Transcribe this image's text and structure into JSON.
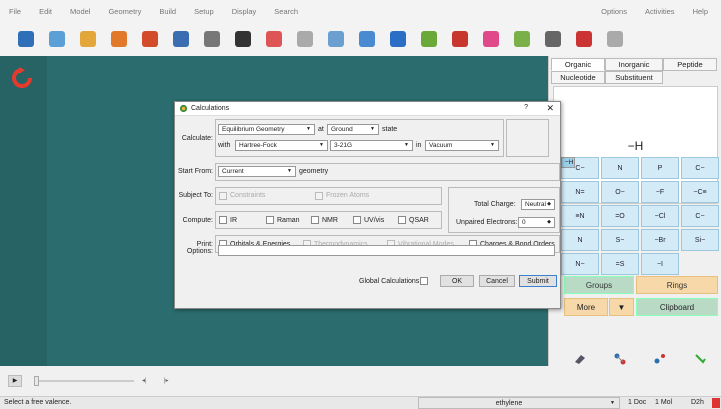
{
  "menu": [
    "File",
    "Edit",
    "Model",
    "Geometry",
    "Build",
    "Setup",
    "Display",
    "Search"
  ],
  "menu_right": [
    "Options",
    "Activities",
    "Help"
  ],
  "toolbar_icons": [
    "new-icon",
    "open-doc-icon",
    "folder-open-icon",
    "folder-import-icon",
    "save-icon",
    "undo-icon",
    "tools-icon",
    "glasses-icon",
    "chemist-icon",
    "person-icon",
    "spreadsheet-icon",
    "document-icon",
    "orbital-icon",
    "dots-icon",
    "surface-icon",
    "spectrum-icon",
    "table-icon",
    "plot-icon",
    "molecule-icon",
    "flask-icon"
  ],
  "right_panel": {
    "tabs_row1": [
      "Organic",
      "Inorganic",
      "Peptide"
    ],
    "tabs_row2": [
      "Nucleotide",
      "Substituent"
    ],
    "preview_label": "−H",
    "fragments": [
      [
        "C−",
        "N",
        "P",
        "−H"
      ],
      [
        "C−",
        "N=",
        "O−",
        "−F"
      ],
      [
        "−C≡",
        "≡N",
        "=O",
        "−Cl"
      ],
      [
        "C−",
        "N",
        "S−",
        "−Br"
      ],
      [
        "Si−",
        "N−",
        "=S",
        "−I"
      ]
    ],
    "groups": "Groups",
    "rings": "Rings",
    "more": "More",
    "clipboard": "Clipboard"
  },
  "dialog": {
    "title": "Calculations",
    "help": "?",
    "close": "✕",
    "calculate_label": "Calculate:",
    "calc_type": "Equilibrium Geometry",
    "at": "at",
    "state": "Ground",
    "state_word": "state",
    "with": "with",
    "method": "Hartree-Fock",
    "basis": "3-21G",
    "in": "in",
    "solvent": "Vacuum",
    "start_from_label": "Start From:",
    "start_from": "Current",
    "geometry_word": "geometry",
    "subject_to_label": "Subject To:",
    "constraints": "Constraints",
    "frozen_atoms": "Frozen Atoms",
    "total_charge_label": "Total Charge:",
    "total_charge": "Neutral",
    "unpaired_label": "Unpaired Electrons:",
    "unpaired": "0",
    "compute_label": "Compute:",
    "compute": [
      "IR",
      "Raman",
      "NMR",
      "UV/vis",
      "QSAR"
    ],
    "print_label": "Print:",
    "print_items": [
      "Orbitals & Energies",
      "Thermodynamics",
      "Vibrational Modes",
      "Charges & Bond Orders"
    ],
    "options_label": "Options:",
    "global_calc": "Global Calculations",
    "ok": "OK",
    "cancel": "Cancel",
    "submit": "Submit"
  },
  "status": {
    "message": "Select a free valence.",
    "molecule": "ethylene",
    "doc": "1 Doc",
    "mol": "1 Mol",
    "view": "D2h"
  }
}
